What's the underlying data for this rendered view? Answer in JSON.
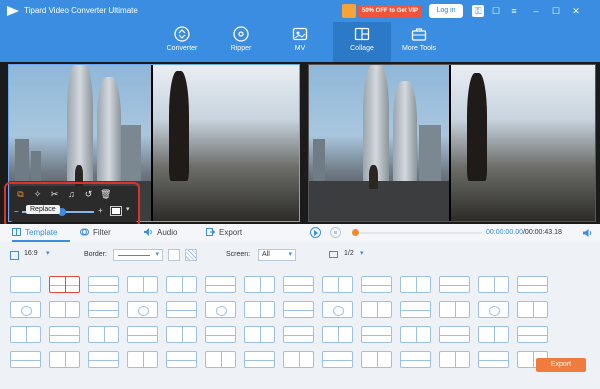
{
  "app": {
    "title": "Tipard Video Converter Ultimate",
    "promo": "50% OFF to Get VIP",
    "login_label": "Log in"
  },
  "nav_tabs": [
    {
      "label": "Converter",
      "icon": "converter-icon"
    },
    {
      "label": "Ripper",
      "icon": "ripper-icon"
    },
    {
      "label": "MV",
      "icon": "mv-icon"
    },
    {
      "label": "Collage",
      "icon": "collage-icon",
      "active": true
    },
    {
      "label": "More Tools",
      "icon": "toolbox-icon"
    }
  ],
  "edit_toolbar": {
    "tooltip": "Replace",
    "tools": [
      "replace-icon",
      "magic-edit-icon",
      "cut-icon",
      "audio-icon",
      "reset-icon",
      "delete-icon"
    ]
  },
  "sub_tabs": [
    {
      "label": "Template",
      "active": true
    },
    {
      "label": "Filter"
    },
    {
      "label": "Audio"
    },
    {
      "label": "Export"
    }
  ],
  "playback": {
    "current_time": "00:00:00.00",
    "total_time": "/00:00:43.18"
  },
  "template_options": {
    "ratio": "16:9",
    "border_label": "Border:",
    "screen_label": "Screen:",
    "screen_value": "All",
    "page_value": "1/2"
  },
  "export_button": "Export",
  "colors": {
    "accent": "#3a8de0",
    "selected_template": "#e34a3a",
    "export_button": "#f07b3f",
    "edit_highlight": "#d9342b"
  }
}
